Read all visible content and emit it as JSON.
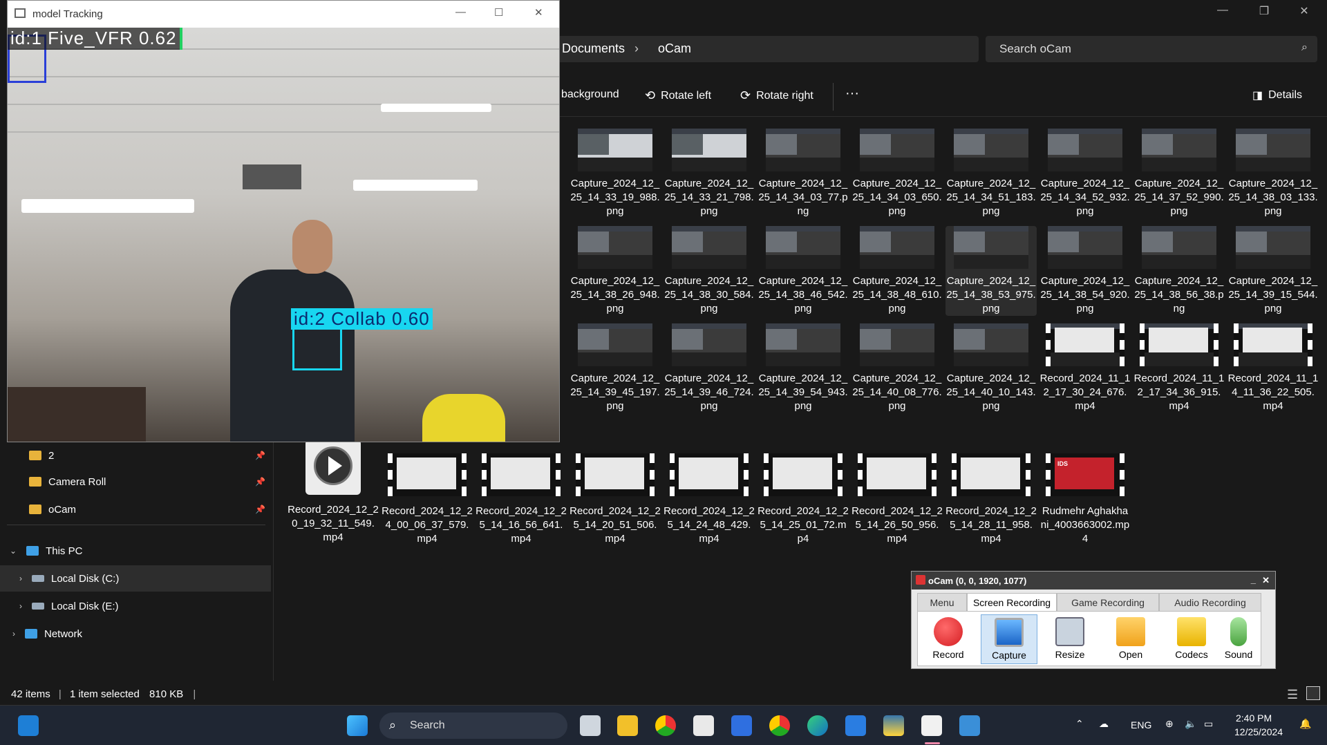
{
  "explorer": {
    "breadcrumb": [
      "Documents",
      "oCam"
    ],
    "search_placeholder": "Search oCam",
    "toolbar": {
      "background": "background",
      "rotate_left": "Rotate left",
      "rotate_right": "Rotate right",
      "more": "···",
      "details": "Details"
    },
    "files": [
      "Capture_2024_12_25_14_33_19_988.png",
      "Capture_2024_12_25_14_33_21_798.png",
      "Capture_2024_12_25_14_34_03_77.png",
      "Capture_2024_12_25_14_34_03_650.png",
      "Capture_2024_12_25_14_34_51_183.png",
      "Capture_2024_12_25_14_34_52_932.png",
      "Capture_2024_12_25_14_37_52_990.png",
      "Capture_2024_12_25_14_38_03_133.png",
      "Capture_2024_12_25_14_38_26_948.png",
      "Capture_2024_12_25_14_38_30_584.png",
      "Capture_2024_12_25_14_38_46_542.png",
      "Capture_2024_12_25_14_38_48_610.png",
      "Capture_2024_12_25_14_38_53_975.png",
      "Capture_2024_12_25_14_38_54_920.png",
      "Capture_2024_12_25_14_38_56_38.png",
      "Capture_2024_12_25_14_39_15_544.png",
      "Capture_2024_12_25_14_39_45_197.png",
      "Capture_2024_12_25_14_39_46_724.png",
      "Capture_2024_12_25_14_39_54_943.png",
      "Capture_2024_12_25_14_40_08_776.png",
      "Capture_2024_12_25_14_40_10_143.png",
      "Record_2024_11_12_17_30_24_676.mp4",
      "Record_2024_11_12_17_34_36_915.mp4",
      "Record_2024_11_14_11_36_22_505.mp4"
    ],
    "files_bottom": [
      "Record_2024_12_20_19_32_11_549.mp4",
      "Record_2024_12_24_00_06_37_579.mp4",
      "Record_2024_12_25_14_16_56_641.mp4",
      "Record_2024_12_25_14_20_51_506.mp4",
      "Record_2024_12_25_14_24_48_429.mp4",
      "Record_2024_12_25_14_25_01_72.mp4",
      "Record_2024_12_25_14_26_50_956.mp4",
      "Record_2024_12_25_14_28_11_958.mp4",
      "Rudmehr Aghakhani_4003663002.mp4"
    ],
    "red_thumb_text": "IDS",
    "nav": {
      "partial_item": "2",
      "camera_roll": "Camera Roll",
      "ocam": "oCam",
      "this_pc": "This PC",
      "local_c": "Local Disk (C:)",
      "local_e": "Local Disk (E:)",
      "network": "Network"
    },
    "status": {
      "items": "42 items",
      "selected": "1 item selected",
      "size": "810 KB"
    }
  },
  "tracker": {
    "title": "model Tracking",
    "detections": [
      {
        "label": "id:1 Five_VFR 0.62",
        "color": "#2a3fd8"
      },
      {
        "label": "id:2 Collab 0.60",
        "color": "#18d6f0"
      }
    ]
  },
  "ocam": {
    "title": "oCam (0, 0, 1920, 1077)",
    "minimize": "_",
    "close": "✕",
    "tabs": [
      "Menu",
      "Screen Recording",
      "Game Recording",
      "Audio Recording"
    ],
    "buttons": [
      "Record",
      "Capture",
      "Resize",
      "Open",
      "Codecs",
      "Sound"
    ]
  },
  "taskbar": {
    "search": "Search",
    "lang": "ENG",
    "time": "2:40 PM",
    "date": "12/25/2024"
  },
  "colors": {
    "accent": "#4cc2ff",
    "folder": "#e8b33b",
    "record_red": "#e0282e"
  }
}
